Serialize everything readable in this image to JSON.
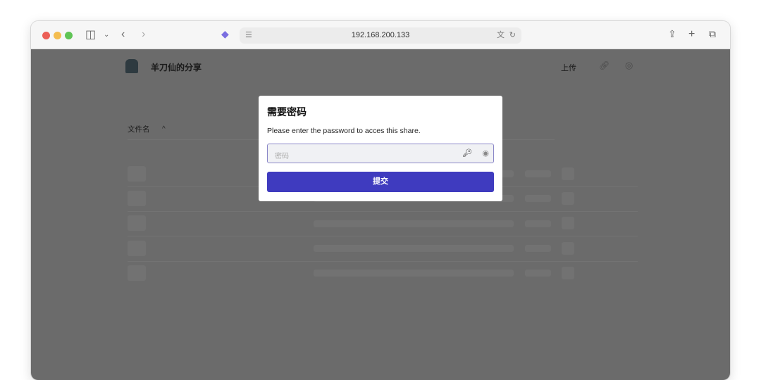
{
  "browser": {
    "url": "192.168.200.133"
  },
  "page": {
    "site_title": "羊刀仙的分享",
    "upload_label": "上传",
    "column_header": "文件名",
    "sort_indicator": "^"
  },
  "modal": {
    "title": "需要密码",
    "message": "Please enter the password to acces this share.",
    "password_placeholder": "密码",
    "submit_label": "提交"
  },
  "colors": {
    "accent": "#3f3bbf"
  }
}
